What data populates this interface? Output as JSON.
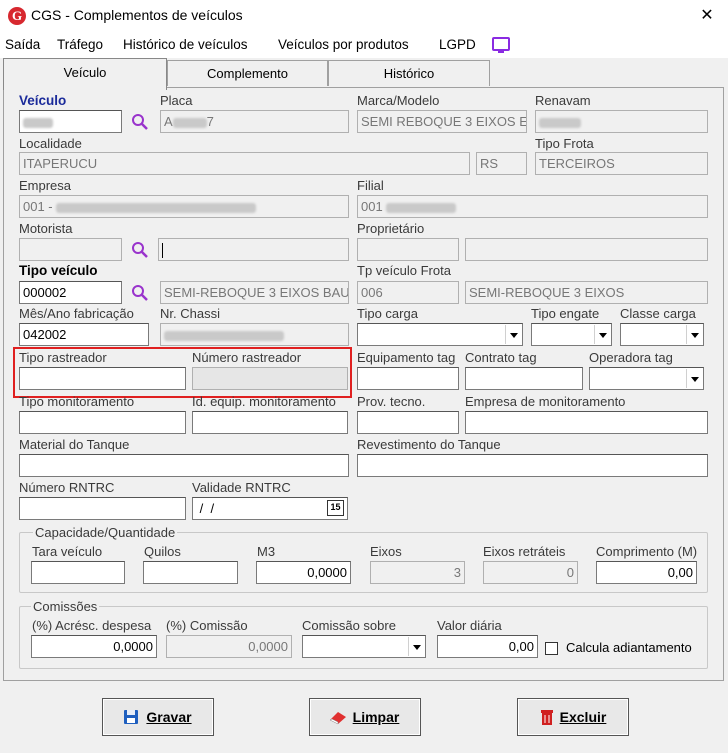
{
  "window": {
    "title": "CGS - Complementos de veículos",
    "logo_letter": "G",
    "close": "✕"
  },
  "menu": {
    "items": [
      "Saída",
      "Tráfego",
      "Histórico de veículos",
      "Veículos por produtos",
      "LGPD"
    ]
  },
  "tabs": [
    "Veículo",
    "Complemento",
    "Histórico"
  ],
  "form": {
    "veiculo_label": "Veículo",
    "placa_label": "Placa",
    "placa_value": "A",
    "placa_suffix": "7",
    "marca_label": "Marca/Modelo",
    "marca_value": "SEMI REBOQUE 3 EIXOS E",
    "renavam_label": "Renavam",
    "localidade_label": "Localidade",
    "localidade_value": "ITAPERUCU",
    "uf_value": "RS",
    "tipo_frota_label": "Tipo Frota",
    "tipo_frota_value": "TERCEIROS",
    "empresa_label": "Empresa",
    "empresa_value": "001 -",
    "filial_label": "Filial",
    "filial_value": "001",
    "motorista_label": "Motorista",
    "proprietario_label": "Proprietário",
    "tipo_veiculo_label": "Tipo veículo",
    "tipo_veiculo_code": "000002",
    "tipo_veiculo_desc": "SEMI-REBOQUE 3 EIXOS BAU",
    "tp_veiculo_frota_label": "Tp veículo Frota",
    "tp_veiculo_frota_code": "006",
    "tp_veiculo_frota_desc": "SEMI-REBOQUE 3 EIXOS",
    "mes_ano_label": "Mês/Ano fabricação",
    "mes_ano_value": "042002",
    "chassi_label": "Nr. Chassi",
    "tipo_carga_label": "Tipo carga",
    "tipo_engate_label": "Tipo engate",
    "classe_carga_label": "Classe carga",
    "tipo_rastreador_label": "Tipo rastreador",
    "numero_rastreador_label": "Número rastreador",
    "equipamento_tag_label": "Equipamento tag",
    "contrato_tag_label": "Contrato tag",
    "operadora_tag_label": "Operadora tag",
    "tipo_monitoramento_label": "Tipo monitoramento",
    "id_equip_label": "Id. equip. monitoramento",
    "prov_tecno_label": "Prov. tecno.",
    "empresa_monit_label": "Empresa de monitoramento",
    "material_tanque_label": "Material do Tanque",
    "revestimento_tanque_label": "Revestimento do Tanque",
    "rntrc_label": "Número RNTRC",
    "validade_rntrc_label": "Validade RNTRC",
    "validade_rntrc_value": " /  /",
    "cal_icon_text": "15"
  },
  "capacidade": {
    "title": "Capacidade/Quantidade",
    "tara_label": "Tara veículo",
    "quilos_label": "Quilos",
    "m3_label": "M3",
    "m3_value": "0,0000",
    "eixos_label": "Eixos",
    "eixos_value": "3",
    "eixos_retrateis_label": "Eixos retráteis",
    "eixos_retrateis_value": "0",
    "comprimento_label": "Comprimento (M)",
    "comprimento_value": "0,00"
  },
  "comissoes": {
    "title": "Comissões",
    "acresc_label": "(%) Acrésc. despesa",
    "acresc_value": "0,0000",
    "comissao_label": "(%) Comissão",
    "comissao_value": "0,0000",
    "comissao_sobre_label": "Comissão sobre",
    "valor_diaria_label": "Valor diária",
    "valor_diaria_value": "0,00",
    "calcula_label": "Calcula adiantamento"
  },
  "buttons": {
    "gravar": "Gravar",
    "limpar": "Limpar",
    "excluir": "Excluir"
  },
  "colors": {
    "highlight": "#e02020",
    "accent_blue": "#1a2a9a",
    "logo_red": "#d7282f",
    "lgpd_purple": "#8a2be2"
  }
}
